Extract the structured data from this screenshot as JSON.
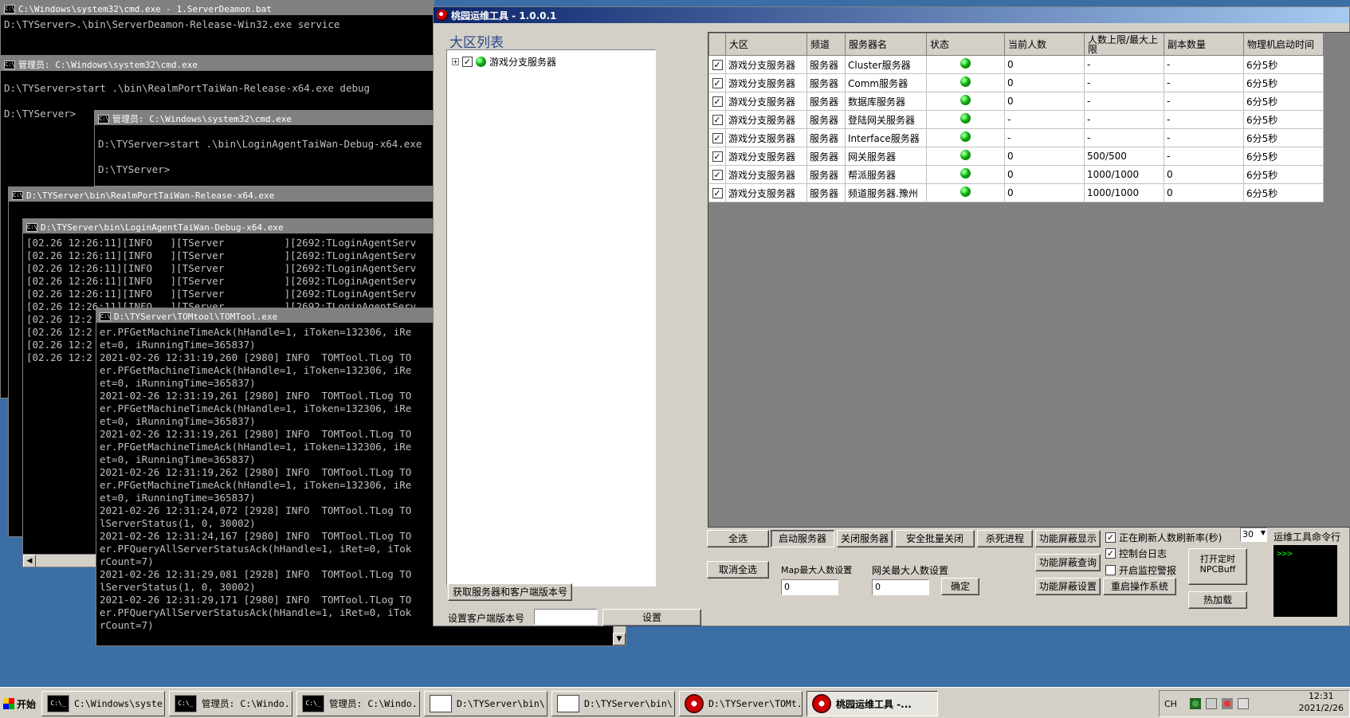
{
  "cmd1": {
    "title": "C:\\Windows\\system32\\cmd.exe - 1.ServerDeamon.bat",
    "body": "D:\\TYServer>.\\bin\\ServerDeamon-Release-Win32.exe service"
  },
  "cmd2": {
    "title": "管理员: C:\\Windows\\system32\\cmd.exe",
    "body": "D:\\TYServer>start .\\bin\\RealmPortTaiWan-Release-x64.exe debug\n\nD:\\TYServer>"
  },
  "cmd3": {
    "title": "管理员: C:\\Windows\\system32\\cmd.exe",
    "body": "D:\\TYServer>start .\\bin\\LoginAgentTaiWan-Debug-x64.exe\n\nD:\\TYServer>"
  },
  "cmd4": {
    "title": "D:\\TYServer\\bin\\RealmPortTaiWan-Release-x64.exe"
  },
  "cmd5": {
    "title": "D:\\TYServer\\bin\\LoginAgentTaiWan-Debug-x64.exe",
    "body": "[02.26 12:26:11][INFO   ][TServer          ][2692:TLoginAgentServ\n[02.26 12:26:11][INFO   ][TServer          ][2692:TLoginAgentServ\n[02.26 12:26:11][INFO   ][TServer          ][2692:TLoginAgentServ\n[02.26 12:26:11][INFO   ][TServer          ][2692:TLoginAgentServ\n[02.26 12:26:11][INFO   ][TServer          ][2692:TLoginAgentServ\n[02.26 12:26:11][INFO   ][TServer          ][2692:TLoginAgentServ\n[02.26 12:2\n[02.26 12:2\n[02.26 12:2\n[02.26 12:2"
  },
  "cmd6": {
    "title": "D:\\TYServer\\TOMtool\\TOMTool.exe",
    "body": "er.PFGetMachineTimeAck(hHandle=1, iToken=132306, iRe\net=0, iRunningTime=365837)\n2021-02-26 12:31:19,260 [2980] INFO  TOMTool.TLog TO\ner.PFGetMachineTimeAck(hHandle=1, iToken=132306, iRe\net=0, iRunningTime=365837)\n2021-02-26 12:31:19,261 [2980] INFO  TOMTool.TLog TO\ner.PFGetMachineTimeAck(hHandle=1, iToken=132306, iRe\net=0, iRunningTime=365837)\n2021-02-26 12:31:19,261 [2980] INFO  TOMTool.TLog TO\ner.PFGetMachineTimeAck(hHandle=1, iToken=132306, iRe\net=0, iRunningTime=365837)\n2021-02-26 12:31:19,262 [2980] INFO  TOMTool.TLog TO\ner.PFGetMachineTimeAck(hHandle=1, iToken=132306, iRe\net=0, iRunningTime=365837)\n2021-02-26 12:31:24,072 [2928] INFO  TOMTool.TLog TO\nlServerStatus(1, 0, 30002)\n2021-02-26 12:31:24,167 [2980] INFO  TOMTool.TLog TO\ner.PFQueryAllServerStatusAck(hHandle=1, iRet=0, iTok\nrCount=7)\n2021-02-26 12:31:29,081 [2928] INFO  TOMTool.TLog TO\nlServerStatus(1, 0, 30002)\n2021-02-26 12:31:29,171 [2980] INFO  TOMTool.TLog TO\ner.PFQueryAllServerStatusAck(hHandle=1, iRet=0, iTok\nrCount=7)"
  },
  "app": {
    "title": "桃园运维工具 - 1.0.0.1",
    "region_list_label": "大区列表",
    "tree_item": "游戏分支服务器",
    "columns": [
      "大区",
      "频道",
      "服务器名",
      "状态",
      "当前人数",
      "人数上限/最大上限",
      "副本数量",
      "物理机启动时间"
    ],
    "rows": [
      {
        "region": "游戏分支服务器",
        "channel": "服务器",
        "name": "Cluster服务器",
        "current": "0",
        "limit": "-",
        "copies": "-",
        "uptime": "6分5秒"
      },
      {
        "region": "游戏分支服务器",
        "channel": "服务器",
        "name": "Comm服务器",
        "current": "0",
        "limit": "-",
        "copies": "-",
        "uptime": "6分5秒"
      },
      {
        "region": "游戏分支服务器",
        "channel": "服务器",
        "name": "数据库服务器",
        "current": "0",
        "limit": "-",
        "copies": "-",
        "uptime": "6分5秒"
      },
      {
        "region": "游戏分支服务器",
        "channel": "服务器",
        "name": "登陆网关服务器",
        "current": "-",
        "limit": "-",
        "copies": "-",
        "uptime": "6分5秒"
      },
      {
        "region": "游戏分支服务器",
        "channel": "服务器",
        "name": "Interface服务器",
        "current": "-",
        "limit": "-",
        "copies": "-",
        "uptime": "6分5秒"
      },
      {
        "region": "游戏分支服务器",
        "channel": "服务器",
        "name": "网关服务器",
        "current": "0",
        "limit": "500/500",
        "copies": "-",
        "uptime": "6分5秒"
      },
      {
        "region": "游戏分支服务器",
        "channel": "服务器",
        "name": "帮派服务器",
        "current": "0",
        "limit": "1000/1000",
        "copies": "0",
        "uptime": "6分5秒"
      },
      {
        "region": "游戏分支服务器",
        "channel": "服务器",
        "name": "频道服务器.豫州",
        "current": "0",
        "limit": "1000/1000",
        "copies": "0",
        "uptime": "6分5秒"
      }
    ],
    "buttons": {
      "select_all": "全选",
      "start_server": "启动服务器",
      "stop_server": "关闭服务器",
      "safe_batch_close": "安全批量关闭",
      "kill_process": "杀死进程",
      "feature_block_show": "功能屏蔽显示",
      "cancel_select_all": "取消全选",
      "confirm": "确定",
      "feature_block_query": "功能屏蔽查询",
      "feature_block_set": "功能屏蔽设置",
      "restart_os": "重启操作系统",
      "open_timer_line1": "打开定时",
      "open_timer_line2": "NPCBuff",
      "hot_load": "热加载",
      "get_version": "获取服务器和客户端版本号",
      "set": "设置"
    },
    "map_max_label": "Map最大人数设置",
    "map_max_value": "0",
    "gw_max_label": "网关最大人数设置",
    "gw_max_value": "0",
    "set_client_version_label": "设置客户端版本号",
    "client_version_value": "",
    "refresh_label": "正在刷新人数刷新率(秒)",
    "refresh_value": "30",
    "console_log_label": "控制台日志",
    "monitor_alarm_label": "开启监控警报",
    "cmd_label": "运维工具命令行",
    "prompt": ">>>"
  },
  "taskbar": {
    "start": "开始",
    "tasks": [
      "C:\\Windows\\syste...",
      "管理员: C:\\Windo...",
      "管理员: C:\\Windo...",
      "D:\\TYServer\\bin\\...",
      "D:\\TYServer\\bin\\...",
      "D:\\TYServer\\TOMt...",
      "桃园运维工具 -..."
    ],
    "lang": "CH",
    "time": "12:31",
    "date": "2021/2/26"
  }
}
